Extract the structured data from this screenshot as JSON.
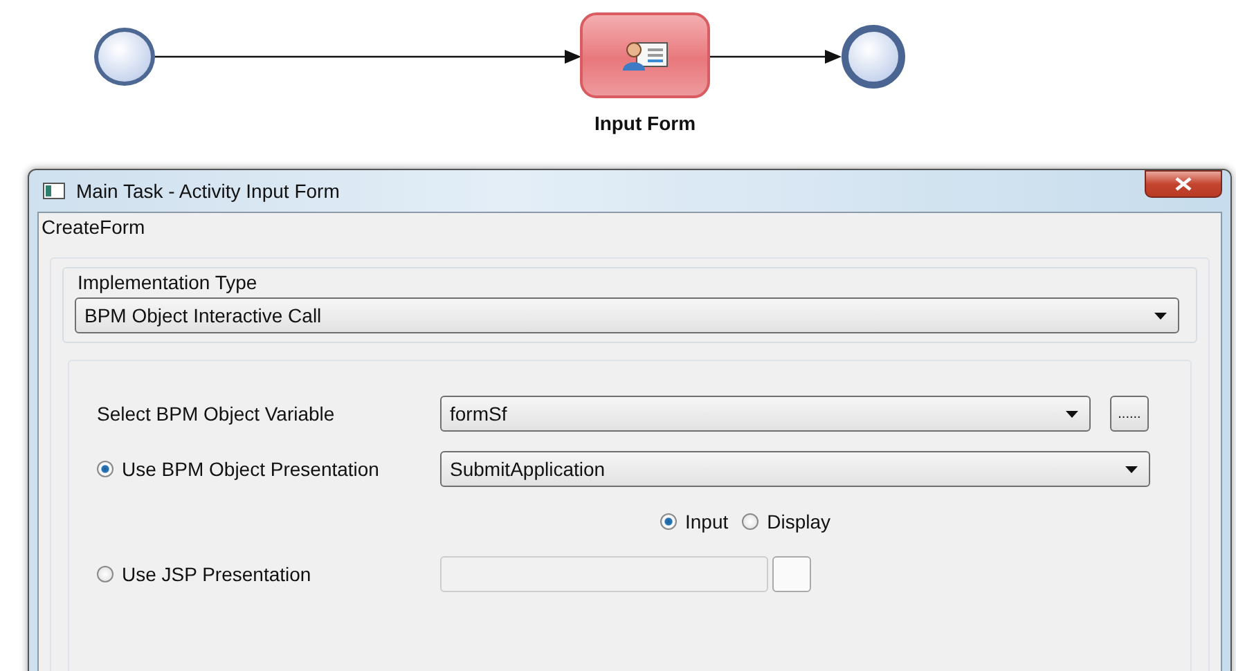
{
  "diagram": {
    "task": {
      "label": "Input Form"
    }
  },
  "dialog": {
    "title": "Main Task - Activity Input Form",
    "section": "CreateForm",
    "implementation_type": {
      "label": "Implementation Type",
      "value": "BPM Object Interactive Call"
    },
    "variable": {
      "label": "Select BPM Object Variable",
      "value": "formSf",
      "browse": "......"
    },
    "presentations": [
      {
        "label": "Use BPM Object Presentation",
        "selected": true,
        "value": "SubmitApplication",
        "disabled": false
      },
      {
        "label": "Use JSP Presentation",
        "selected": false,
        "disabled": true
      }
    ],
    "modes": [
      {
        "label": "Input",
        "selected": true
      },
      {
        "label": "Display",
        "selected": false
      }
    ]
  }
}
